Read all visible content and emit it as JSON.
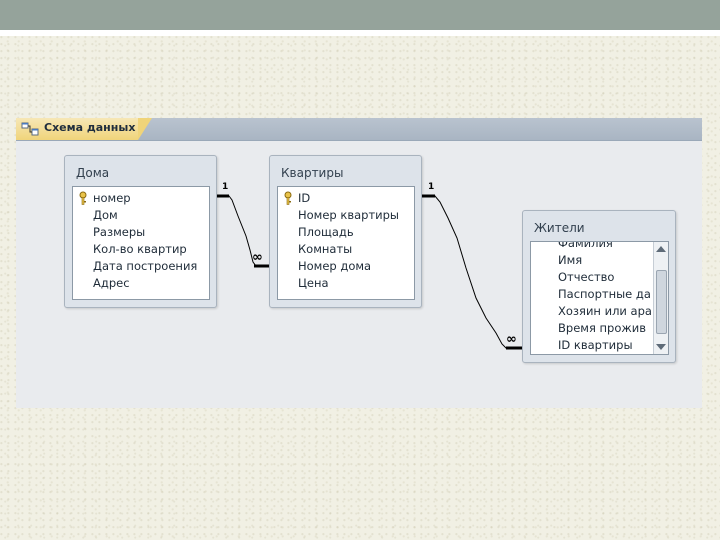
{
  "window": {
    "tab_label": "Схема данных",
    "tab_icon": "relationships-icon"
  },
  "tables": {
    "doma": {
      "title": "Дома",
      "fields": [
        "номер",
        "Дом",
        "Размеры",
        "Кол-во квартир",
        "Дата построения",
        "Адрес"
      ],
      "key_field": "номер"
    },
    "kvartiry": {
      "title": "Квартиры",
      "fields": [
        "ID",
        "Номер квартиры",
        "Площадь",
        "Комнаты",
        "Номер дома",
        "Цена"
      ],
      "key_field": "ID"
    },
    "zhiteli": {
      "title": "Жители",
      "fields": [
        "Фамилия",
        "Имя",
        "Отчество",
        "Паспортные да",
        "Хозяин или ара",
        "Время прожив",
        "ID квартиры"
      ]
    }
  },
  "relationships": [
    {
      "from": "Дома",
      "to": "Квартиры",
      "one_label": "1",
      "many_label": "∞"
    },
    {
      "from": "Квартиры",
      "to": "Жители",
      "one_label": "1",
      "many_label": "∞"
    }
  ],
  "colors": {
    "top_bar": "#95a39b",
    "tab": "#f0d47a",
    "window_background": "#e9ebee"
  }
}
